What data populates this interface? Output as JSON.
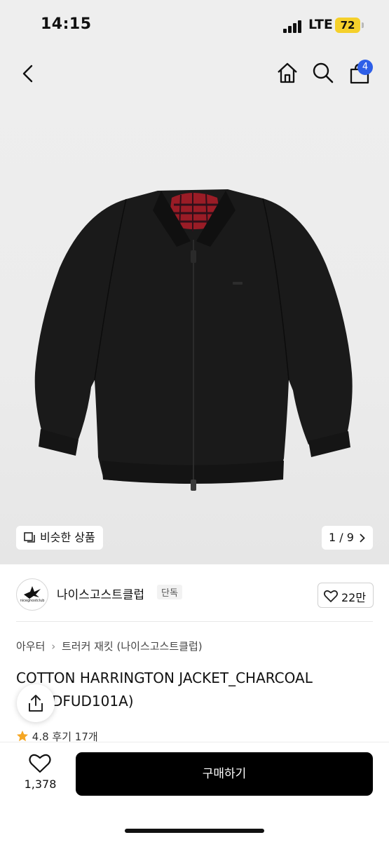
{
  "status_bar": {
    "time": "14:15",
    "network": "LTE",
    "battery": "72"
  },
  "nav": {
    "cart_count": "4",
    "icons": [
      "back-icon",
      "home-icon",
      "search-icon",
      "cart-icon"
    ]
  },
  "gallery": {
    "similar_label": "비슷한 상품",
    "page_indicator": "1 / 9"
  },
  "brand": {
    "logo_text": "niceghostclub",
    "name": "나이스고스트클럽",
    "tag": "단독",
    "likes": "22만"
  },
  "product": {
    "breadcrumb": [
      "아우터",
      "트러커 재킷 (나이스고스트클럽)"
    ],
    "title_line1": "COTTON HARRINGTON JACKET_CHARCOAL",
    "title_line2": "(NG2DFUD101A)",
    "rating": "4.8",
    "reviews": "후기 17개"
  },
  "bottom_bar": {
    "wish_count": "1,378",
    "buy_label": "구매하기"
  },
  "colors": {
    "accent_badge": "#2e5fe8",
    "buy_button": "#000000",
    "star": "#f5a623"
  }
}
